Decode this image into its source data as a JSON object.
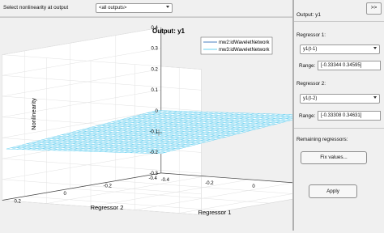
{
  "toolbar": {
    "select_label": "Select nonlinearity at output",
    "output_select_value": "<all outputs>"
  },
  "plot": {
    "title": "Output: y1",
    "legend": [
      "mw2:idWaveletNetwork",
      "mw3:idWaveletNetwork"
    ],
    "zlabel": "Nonlinearity",
    "xlabel": "Regressor 1",
    "ylabel": "Regressor 2",
    "z_ticks": [
      "0.4",
      "0.3",
      "0.2",
      "0.1",
      "0",
      "-0.1",
      "-0.2",
      "-0.3"
    ],
    "x_ticks": [
      "-0.4",
      "-0.2",
      "0",
      "0.2",
      "0.4"
    ],
    "y_ticks": [
      "0.2",
      "0",
      "-0.2",
      "-0.4"
    ]
  },
  "panel": {
    "title": "Output: y1",
    "collapse_label": ">>",
    "regressor1_label": "Regressor 1:",
    "regressor1_value": "y1(t-1)",
    "range_label": "Range:",
    "regressor1_range": "[-0.33344    0.34595]",
    "regressor2_label": "Regressor 2:",
    "regressor2_value": "y1(t-2)",
    "regressor2_range": "[-0.33308    0.34631]",
    "remaining_label": "Remaining regressors:",
    "fix_values_label": "Fix values...",
    "apply_label": "Apply"
  },
  "colors": {
    "surface_line": "#6ad0f0",
    "surface_fill": "#ffffff",
    "legend_line1": "#4a7fc0",
    "legend_line2": "#6ad0f0"
  }
}
